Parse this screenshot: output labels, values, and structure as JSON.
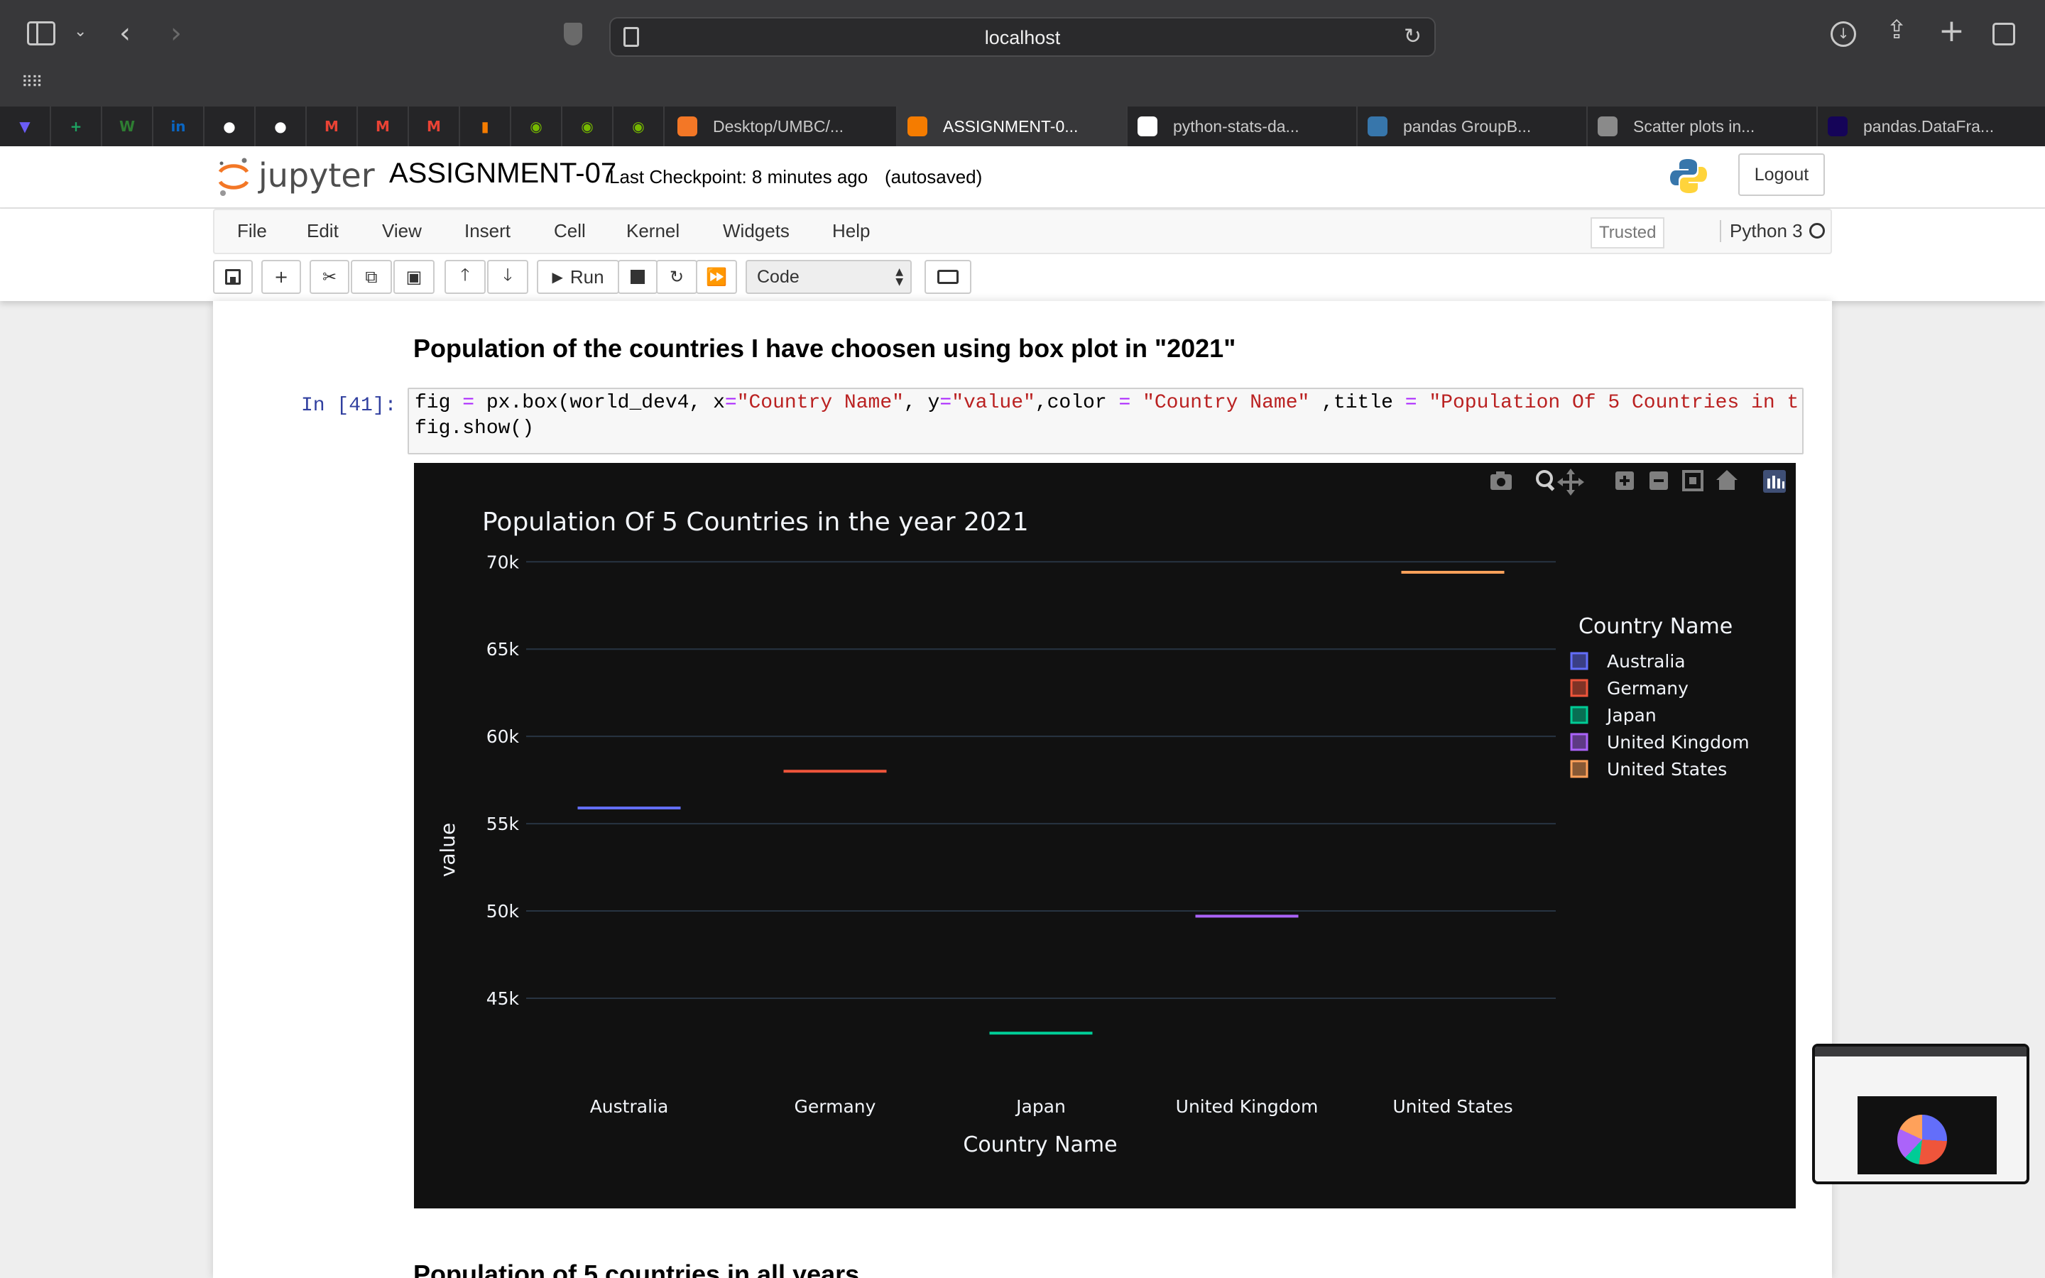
{
  "browser": {
    "url": "localhost",
    "pinned": [
      {
        "icon": "proton-icon",
        "glyph": "▼",
        "color": "#6b5cf6"
      },
      {
        "icon": "sheets-icon",
        "glyph": "+",
        "color": "#1ea362"
      },
      {
        "icon": "w-icon",
        "glyph": "W",
        "color": "#2e7d32"
      },
      {
        "icon": "linkedin-icon",
        "glyph": "in",
        "color": "#0a66c2"
      },
      {
        "icon": "github-icon",
        "glyph": "●",
        "color": "#ffffff"
      },
      {
        "icon": "github-icon",
        "glyph": "●",
        "color": "#ffffff"
      },
      {
        "icon": "gmail-icon",
        "glyph": "M",
        "color": "#ea4335"
      },
      {
        "icon": "gmail-icon",
        "glyph": "M",
        "color": "#ea4335"
      },
      {
        "icon": "gmail-icon",
        "glyph": "M",
        "color": "#ea4335"
      },
      {
        "icon": "bag-icon",
        "glyph": "▮",
        "color": "#f57c00"
      },
      {
        "icon": "nvidia-icon",
        "glyph": "◉",
        "color": "#76b900"
      },
      {
        "icon": "nvidia-icon",
        "glyph": "◉",
        "color": "#76b900"
      },
      {
        "icon": "nvidia-icon",
        "glyph": "◉",
        "color": "#76b900"
      }
    ],
    "tabs": [
      {
        "label": "Desktop/UMBC/...",
        "icon": "jupyter-icon",
        "active": false
      },
      {
        "label": "ASSIGNMENT-0...",
        "icon": "notebook-icon",
        "active": true
      },
      {
        "label": "python-stats-da...",
        "icon": "github-icon",
        "active": false
      },
      {
        "label": "pandas GroupB...",
        "icon": "python-icon",
        "active": false
      },
      {
        "label": "Scatter plots in...",
        "icon": "p-icon",
        "active": false
      },
      {
        "label": "pandas.DataFra...",
        "icon": "pandas-icon",
        "active": false
      }
    ]
  },
  "jupyter": {
    "brand": "jupyter",
    "notebook_name": "ASSIGNMENT-07",
    "checkpoint": "Last Checkpoint: 8 minutes ago",
    "autosave": "(autosaved)",
    "logout": "Logout",
    "menu": [
      "File",
      "Edit",
      "View",
      "Insert",
      "Cell",
      "Kernel",
      "Widgets",
      "Help"
    ],
    "trusted": "Trusted",
    "kernel": "Python 3",
    "toolbar": {
      "run": "Run",
      "cell_type": "Code"
    }
  },
  "cell": {
    "heading": "Population of the countries I have choosen using box plot in \"2021\"",
    "prompt": "In [41]:",
    "code_line1": {
      "a": "fig ",
      "op1": "=",
      "b": " px.box(world_dev4, x",
      "op2": "=",
      "s1": "\"Country Name\"",
      "c": ", y",
      "op3": "=",
      "s2": "\"value\"",
      "d": ",color ",
      "op4": "=",
      "e": " ",
      "s3": "\"Country Name\"",
      "f": " ,title ",
      "op5": "=",
      "g": " ",
      "s4": "\"Population Of 5 Countries in t"
    },
    "code_line2": "fig.show()"
  },
  "next_heading": "Population of 5 countries in all years",
  "chart_data": {
    "type": "box",
    "title": "Population Of 5 Countries in the year 2021",
    "xlabel": "Country Name",
    "ylabel": "value",
    "categories": [
      "Australia",
      "Germany",
      "Japan",
      "United Kingdom",
      "United States"
    ],
    "values": [
      55900,
      58000,
      43000,
      49700,
      69400
    ],
    "colors": [
      "#636efa",
      "#ef553b",
      "#00cc96",
      "#ab63fa",
      "#ffa15a"
    ],
    "yticks": [
      45000,
      50000,
      55000,
      60000,
      65000,
      70000
    ],
    "ytick_labels": [
      "45k",
      "50k",
      "55k",
      "60k",
      "65k",
      "70k"
    ],
    "ylim": [
      41500,
      71800
    ],
    "legend_title": "Country Name",
    "legend_position": "right",
    "grid": true,
    "theme": "plotly_dark"
  }
}
